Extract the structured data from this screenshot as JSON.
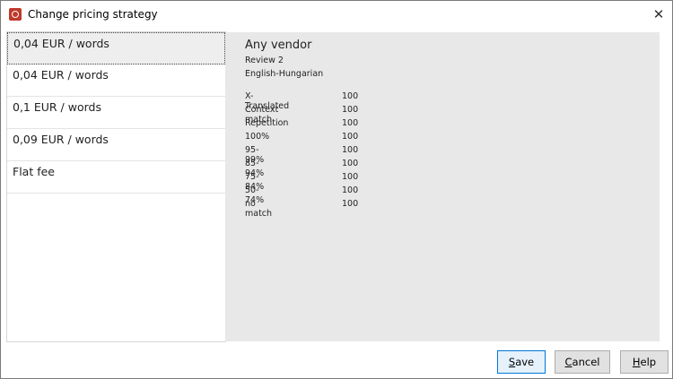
{
  "window": {
    "title": "Change pricing strategy",
    "close": "✕"
  },
  "pricing_list": [
    {
      "label": "0,04 EUR / words",
      "selected": true
    },
    {
      "label": "0,04 EUR / words",
      "selected": false
    },
    {
      "label": "0,1 EUR / words",
      "selected": false
    },
    {
      "label": "0,09 EUR / words",
      "selected": false
    },
    {
      "label": "Flat fee",
      "selected": false
    }
  ],
  "details": {
    "vendor": "Any vendor",
    "review": "Review 2",
    "language_pair": "English-Hungarian",
    "rates": [
      {
        "label": "X-Translated",
        "value": "100"
      },
      {
        "label": "Context match",
        "value": "100"
      },
      {
        "label": "Repetition",
        "value": "100"
      },
      {
        "label": "100%",
        "value": "100"
      },
      {
        "label": "95-99%",
        "value": "100"
      },
      {
        "label": "85-94%",
        "value": "100"
      },
      {
        "label": "75-84%",
        "value": "100"
      },
      {
        "label": "50-74%",
        "value": "100"
      },
      {
        "label": "no match",
        "value": "100"
      }
    ]
  },
  "buttons": {
    "save_first": "S",
    "save_rest": "ave",
    "cancel_first": "C",
    "cancel_rest": "ancel",
    "help_first": "H",
    "help_rest": "elp"
  }
}
